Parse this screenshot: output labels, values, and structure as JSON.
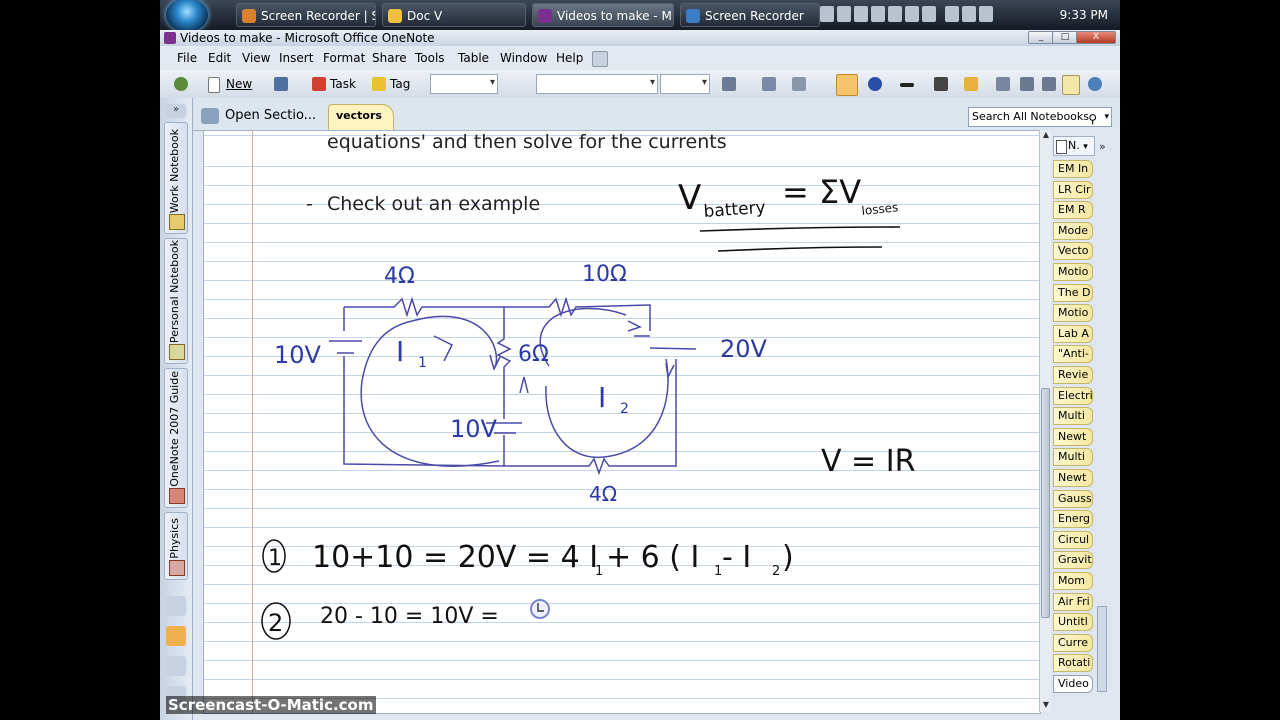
{
  "taskbar": {
    "buttons": [
      {
        "label": "Screen Recorder | S...",
        "color": "#d9822b"
      },
      {
        "label": "Doc V",
        "color": "#f0c040"
      },
      {
        "label": "Videos to make - M...",
        "color": "#7b2f8f"
      },
      {
        "label": "Screen Recorder",
        "color": "#3b7dc4"
      }
    ],
    "clock": "9:33 PM"
  },
  "window": {
    "title": "Videos to make - Microsoft Office OneNote",
    "controls": {
      "minimize": "_",
      "maximize": "□",
      "close": "X"
    }
  },
  "menubar": [
    "File",
    "Edit",
    "View",
    "Insert",
    "Format",
    "Share",
    "Tools",
    "Table",
    "Window",
    "Help"
  ],
  "toolbar": {
    "new_label": "New",
    "task_label": "Task",
    "tag_label": "Tag"
  },
  "notebooks": [
    "Work Notebook",
    "Personal Notebook",
    "OneNote 2007 Guide",
    "Physics"
  ],
  "section_strip": {
    "open_sections": "Open Sectio...",
    "active_tab": "vectors"
  },
  "search": {
    "placeholder": "Search All Notebooks"
  },
  "page": {
    "line1": "equations' and then solve for the currents",
    "bullet_dash": "-",
    "line2": "Check out an example"
  },
  "ink": {
    "kvl": [
      "V",
      "battery",
      "= ΣV",
      "losses"
    ],
    "ohm": "V = IR",
    "resistors": [
      "4Ω",
      "10Ω",
      "6Ω",
      "4Ω"
    ],
    "batteries": [
      "10V",
      "20V",
      "10V"
    ],
    "loops": [
      "I",
      "1",
      "I",
      "2"
    ],
    "eq1_num": "1",
    "eq1": [
      "10+10 = 20V = 4 I",
      "1",
      "+ 6 ( I",
      "1",
      " - I",
      "2",
      " )"
    ],
    "eq2_num": "2",
    "eq2": "20 - 10 = 10V ="
  },
  "page_tabs": {
    "header": "N.",
    "items": [
      "EM In",
      "LR Cir",
      "EM R",
      "Mode",
      "Vecto",
      "Motio",
      "The D",
      "Motio",
      "Lab A",
      "\"Anti-",
      "Revie",
      "Electri",
      "Multi",
      "Newt",
      "Multi",
      "Newt",
      "Gauss",
      "Energ",
      "Circul",
      "Gravit",
      "Mom",
      "Air Fri",
      "Untitl",
      "Curre",
      "Rotati",
      "Video"
    ],
    "selected_index": 25
  },
  "watermark": "Screencast-O-Matic.com"
}
